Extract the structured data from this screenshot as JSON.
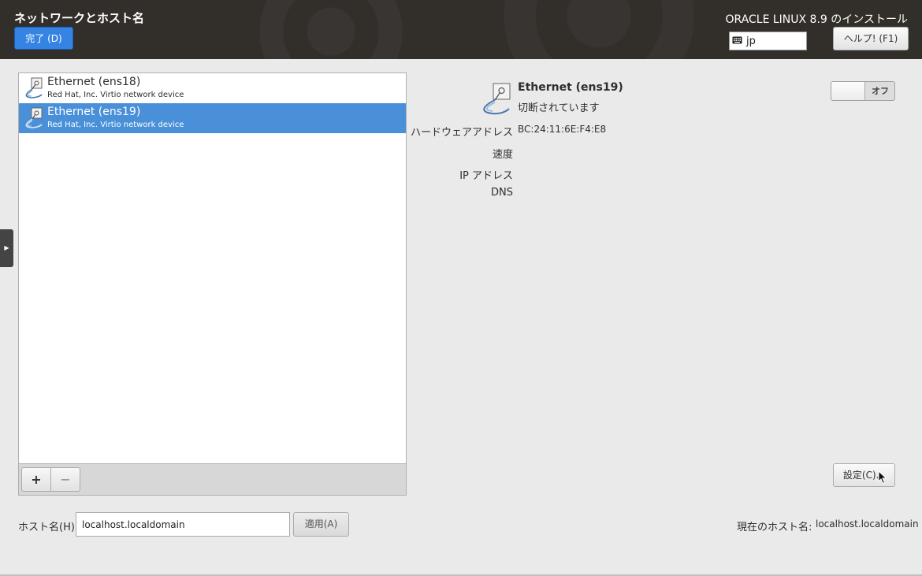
{
  "header": {
    "title": "ネットワークとホスト名",
    "done_label": "完了 (D)",
    "install_title": "ORACLE LINUX 8.9 のインストール",
    "keyboard_layout": "jp",
    "help_label": "ヘルプ! (F1)"
  },
  "devices": [
    {
      "name": "Ethernet (ens18)",
      "description": "Red Hat, Inc. Virtio network device",
      "selected": false
    },
    {
      "name": "Ethernet (ens19)",
      "description": "Red Hat, Inc. Virtio network device",
      "selected": true
    }
  ],
  "toolbar": {
    "add_label": "+",
    "remove_label": "−"
  },
  "details": {
    "name": "Ethernet (ens19)",
    "status": "切断されています",
    "hw_label": "ハードウェアアドレス",
    "hw_value": "BC:24:11:6E:F4:E8",
    "speed_label": "速度",
    "ip_label": "IP アドレス",
    "dns_label": "DNS",
    "toggle_label": "オフ",
    "settings_label": "設定(C)..."
  },
  "hostname": {
    "label": "ホスト名(H):",
    "value": "localhost.localdomain",
    "apply_label": "適用(A)",
    "current_label": "現在のホスト名:",
    "current_value": "localhost.localdomain"
  },
  "colors": {
    "accent": "#3584e4",
    "selected_row": "#4a90d9",
    "header_bg": "#322e2a"
  }
}
